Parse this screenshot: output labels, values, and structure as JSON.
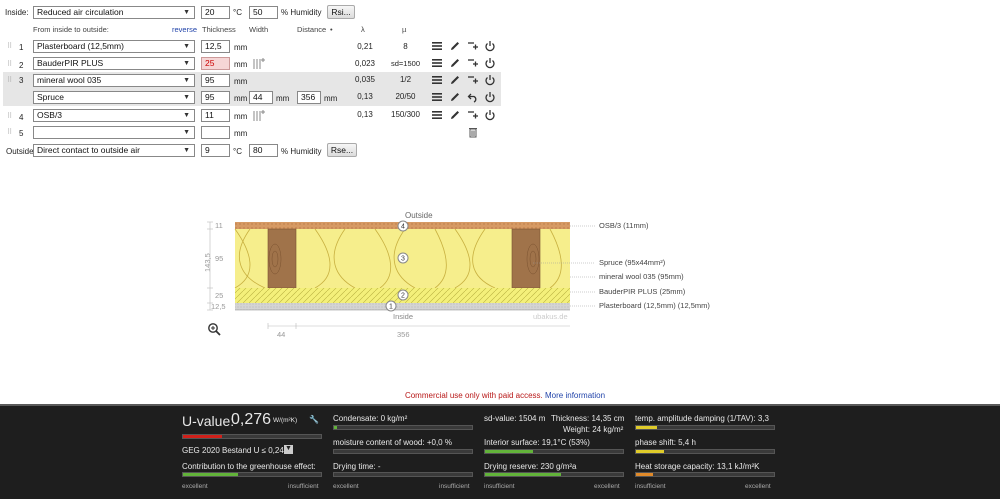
{
  "inside": {
    "label": "Inside:",
    "select": "Reduced air circulation",
    "temp": "20",
    "temp_unit": "°C",
    "humidity": "50",
    "humidity_unit": "% Humidity",
    "btn": "Rsi..."
  },
  "columns": {
    "from": "From inside to outside:",
    "reverse": "reverse",
    "thickness": "Thickness",
    "width": "Width",
    "distance": "Distance",
    "lambda": "λ",
    "mu": "µ"
  },
  "layers": [
    {
      "no": "1",
      "name": "Plasterboard (12,5mm)",
      "thickness": "12,5",
      "unit": "mm",
      "lambda": "0,21",
      "mu": "8"
    },
    {
      "no": "2",
      "name": "BauderPIR PLUS",
      "thickness": "25",
      "unit": "mm",
      "lambda": "0,023",
      "mu": "sd=1500"
    },
    {
      "no": "3",
      "name": "mineral wool 035",
      "thickness": "95",
      "unit": "mm",
      "lambda": "0,035",
      "mu": "1/2"
    },
    {
      "no": "",
      "name": "Spruce",
      "thickness": "95",
      "unit": "mm",
      "width": "44",
      "width_unit": "mm",
      "distance": "356",
      "distance_unit": "mm",
      "lambda": "0,13",
      "mu": "20/50"
    },
    {
      "no": "4",
      "name": "OSB/3",
      "thickness": "11",
      "unit": "mm",
      "lambda": "0,13",
      "mu": "150/300"
    },
    {
      "no": "5",
      "name": "",
      "thickness": "",
      "unit": "mm",
      "lambda": "",
      "mu": ""
    }
  ],
  "outside": {
    "label": "Outside",
    "select": "Direct contact to outside air",
    "temp": "9",
    "temp_unit": "°C",
    "humidity": "80",
    "humidity_unit": "% Humidity",
    "btn": "Rse..."
  },
  "diagram": {
    "outside": "Outside",
    "inside": "Inside",
    "watermark": "ubakus.de",
    "left_dims": [
      "11",
      "95",
      "25",
      "12,5"
    ],
    "total": "143,5",
    "bottom_dims": [
      "44",
      "356"
    ],
    "markers": [
      "4",
      "3",
      "2",
      "1"
    ],
    "labels": [
      "OSB/3 (11mm)",
      "Spruce (95x44mm²)",
      "mineral wool 035 (95mm)",
      "BauderPIR PLUS (25mm)",
      "Plasterboard (12,5mm) (12,5mm)"
    ]
  },
  "notice": {
    "text": "Commercial use only with paid access.",
    "link": "More information"
  },
  "results": {
    "uvalue_label": "U-value:",
    "uvalue": "0,276",
    "uvalue_unit": "W/(m²K)",
    "geg": "GEG 2020 Bestand U ≤ 0,24",
    "greenhouse": "Contribution to the greenhouse effect:",
    "condensate": "Condensate: 0 kg/m²",
    "moisture": "moisture content of wood: +0,0 %",
    "drying_time": "Drying time: -",
    "sd": "sd-value: 1504 m",
    "thickness": "Thickness: 14,35 cm",
    "weight": "Weight: 24 kg/m²",
    "interior": "Interior surface: 19,1°C (53%)",
    "drying_reserve": "Drying reserve: 230 g/m²a",
    "damping": "temp. amplitude damping (1/TAV): 3,3",
    "phase": "phase shift: 5,4 h",
    "heat": "Heat storage capacity: 13,1 kJ/m²K",
    "excellent": "excellent",
    "insufficient": "insufficient",
    "uvalue_level": 0.28,
    "greenhouse_level": 0.4,
    "condensate_level": 0.02,
    "moisture_level": 0.0,
    "drying_level": 0.0,
    "interior_level": 0.35,
    "reserve_level": 0.55,
    "damping_level": 0.15,
    "phase_level": 0.2,
    "heat_level": 0.12,
    "colors": {
      "red": "#d0201a",
      "green": "#62b33a",
      "yellow": "#e0cc2a",
      "orange": "#e08a2a"
    }
  }
}
